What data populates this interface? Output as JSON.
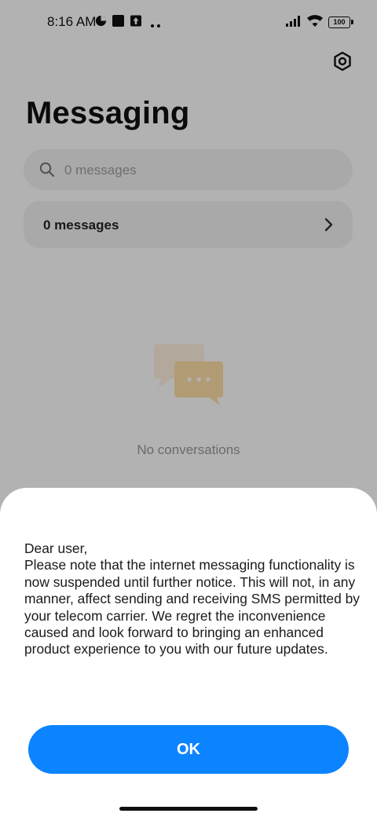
{
  "status_bar": {
    "time": "8:16 AM",
    "battery": "100"
  },
  "header": {
    "title": "Messaging",
    "settings_icon": "gear-icon"
  },
  "search": {
    "placeholder": "0 messages"
  },
  "messages_card": {
    "label": "0 messages"
  },
  "empty_state": {
    "icon": "chat-bubbles-icon",
    "text": "No conversations"
  },
  "dialog": {
    "greeting": "Dear user,",
    "body": "Please note that the internet messaging functionality is now suspended until further notice. This will not, in any manner, affect sending and receiving SMS permitted by your telecom carrier. We regret the inconvenience caused and look forward to bringing an enhanced product experience to you with our future updates.",
    "ok_label": "OK"
  },
  "colors": {
    "accent": "#0d84ff",
    "background": "#ffffff",
    "text": "#1a1a1a"
  }
}
